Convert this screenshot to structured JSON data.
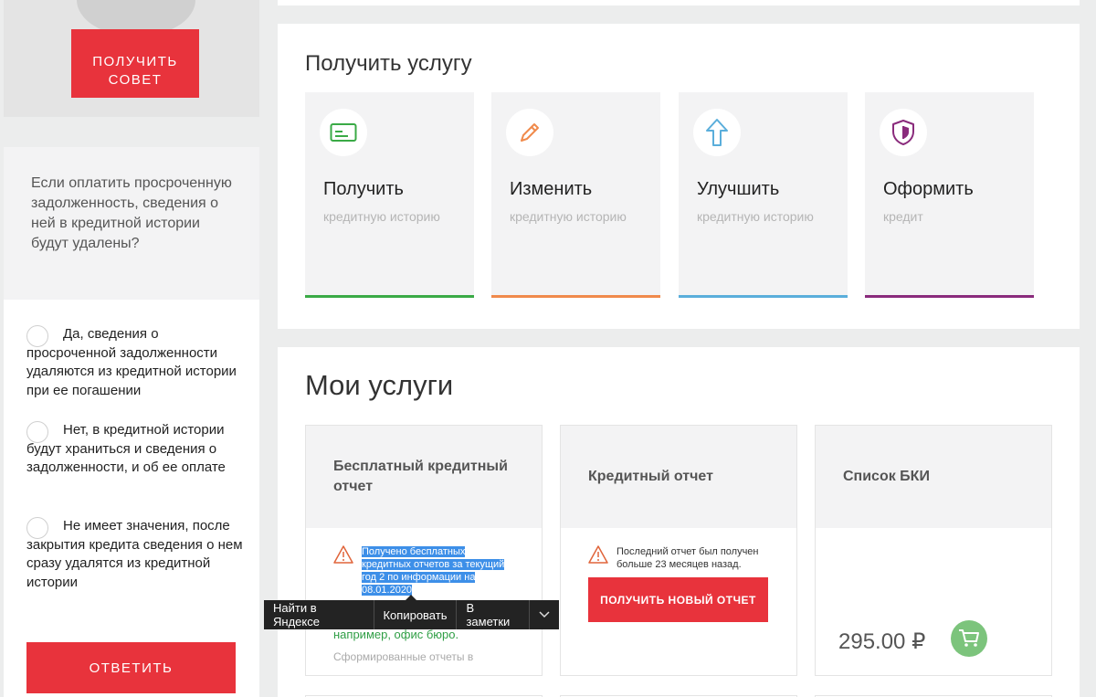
{
  "promo": {
    "button_label": "ПОЛУЧИТЬ\nСОВЕТ"
  },
  "quiz": {
    "question": "Если оплатить просроченную задолженность, сведения о ней в кредитной истории будут удалены?",
    "options": [
      {
        "label": "Да, сведения о просроченной задолженности удаляются из кредитной истории при ее погашении"
      },
      {
        "label": "Нет, в кредитной истории будут храниться и сведения о задолженности, и об ее оплате"
      },
      {
        "label": "Не имеет значения, после закрытия кредита сведения о нем сразу удалятся из кредитной истории"
      }
    ],
    "answer_label": "ОТВЕТИТЬ"
  },
  "get_service": {
    "title": "Получить услугу",
    "cards": [
      {
        "title": "Получить",
        "subtitle": "кредитную историю",
        "icon": "card-icon",
        "color": "#3aaa46"
      },
      {
        "title": "Изменить",
        "subtitle": "кредитную историю",
        "icon": "pencil-icon",
        "color": "#f08a4b"
      },
      {
        "title": "Улучшить",
        "subtitle": "кредитную историю",
        "icon": "arrow-up-icon",
        "color": "#5aaedb"
      },
      {
        "title": "Оформить",
        "subtitle": "кредит",
        "icon": "shield-icon",
        "color": "#8a2b7c"
      }
    ]
  },
  "my_services": {
    "title": "Мои услуги",
    "cards": [
      {
        "title": "Бесплатный кредитный отчет",
        "note_lines": [
          "Получено бесплатных",
          "кредитных отчетов за текущий",
          "год 2 по информации на",
          "08.01.2020"
        ],
        "green_text": "например, офис бюро.",
        "grey_text": "Сформированные отчеты в"
      },
      {
        "title": "Кредитный отчет",
        "note_lines": [
          "Последний отчет был получен",
          "больше 23 месяцев назад."
        ],
        "button_label": "ПОЛУЧИТЬ НОВЫЙ ОТЧЕТ"
      },
      {
        "title": "Список БКИ",
        "price": "295.00 ₽"
      }
    ]
  },
  "context_menu": {
    "items": [
      "Найти в Яндексе",
      "Копировать",
      "В заметки"
    ]
  },
  "colors": {
    "accent_red": "#e8333c",
    "cart_green": "#7cc47c",
    "selection_blue": "#3d8fe8"
  }
}
